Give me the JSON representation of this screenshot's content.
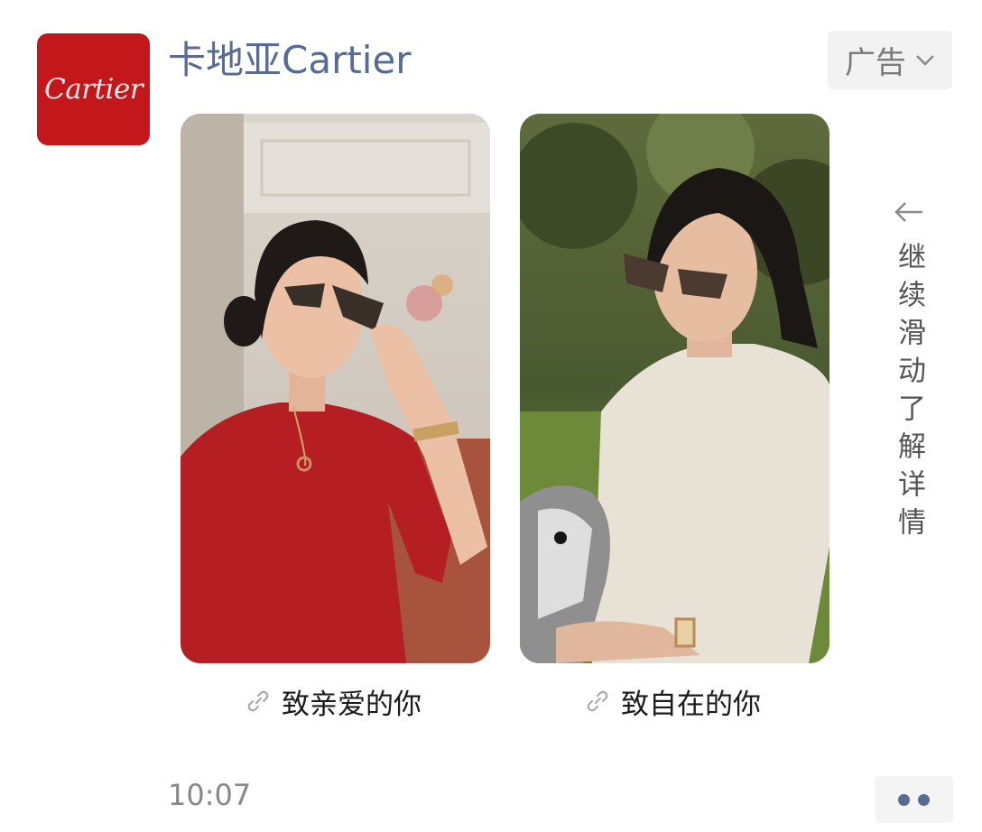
{
  "account": {
    "name": "卡地亚Cartier",
    "avatar_logo_text": "Cartier",
    "brand_color": "#c3171c",
    "name_color": "#576b95"
  },
  "ad_badge": {
    "label": "广告",
    "icon": "chevron-down-icon"
  },
  "cards": [
    {
      "caption": "致亲爱的你",
      "icon": "link-icon",
      "image_alt": "woman-in-red-sweater-with-sunglasses"
    },
    {
      "caption": "致自在的你",
      "icon": "link-icon",
      "image_alt": "woman-in-cream-sweater-with-dog"
    }
  ],
  "swipe_hint": {
    "text": "继续滑动了解详情",
    "icon": "arrow-left-icon"
  },
  "footer": {
    "time": "10:07",
    "more_icon": "more-dots-icon"
  }
}
